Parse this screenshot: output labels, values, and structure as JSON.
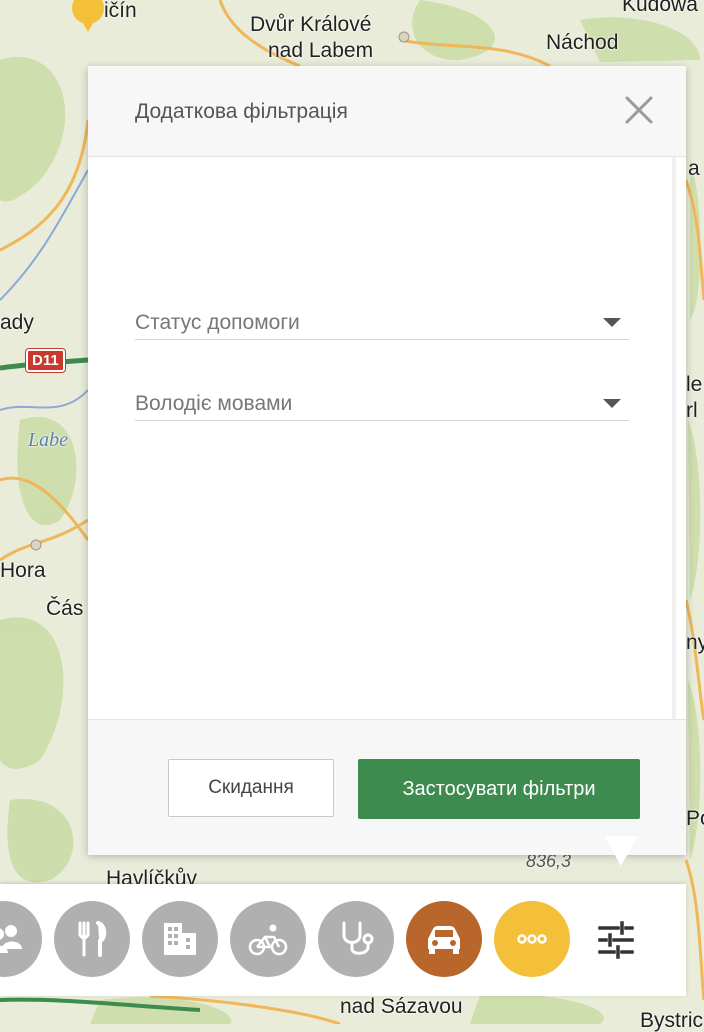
{
  "map": {
    "labels": {
      "jicin": "ičín",
      "dvur": "Dvůr Králové",
      "nad_labem": "nad Labem",
      "nachod": "Náchod",
      "kudowa": "Kudowa",
      "rady": "ady",
      "labe": "Labe",
      "hora": "Hora",
      "cas": "Čás",
      "havlickuv": "Havlíčkův",
      "nad_sazavou": "nad Sázavou",
      "elev": "836,3",
      "bystr": "Bystric",
      "r_a": "a",
      "r_le": "le",
      "r_rl": "rl",
      "r_ny": "ny",
      "r_po": "Po"
    },
    "road_sign": "D11",
    "colors": {
      "land": "#e9ecd9",
      "forest": "#c9dca5",
      "road": "#f0b65a",
      "highway": "#3d8b4f"
    }
  },
  "modal": {
    "title": "Додаткова фільтрація",
    "close_icon": "close-icon",
    "fields": [
      {
        "label": "Статус допомоги"
      },
      {
        "label": "Володіє мовами"
      }
    ],
    "reset_label": "Скидання",
    "apply_label": "Застосувати фільтри",
    "colors": {
      "apply": "#3d8b4f"
    }
  },
  "toolbar": {
    "categories": [
      {
        "icon": "people-icon",
        "color": "#b0b0b0"
      },
      {
        "icon": "food-icon",
        "color": "#b0b0b0"
      },
      {
        "icon": "building-icon",
        "color": "#b0b0b0"
      },
      {
        "icon": "bicycle-icon",
        "color": "#b0b0b0"
      },
      {
        "icon": "stethoscope-icon",
        "color": "#b0b0b0"
      },
      {
        "icon": "car-icon",
        "color": "#b8662c"
      },
      {
        "icon": "more-icon",
        "color": "#f4c03a"
      }
    ],
    "filter_icon": "filter-sliders-icon"
  }
}
